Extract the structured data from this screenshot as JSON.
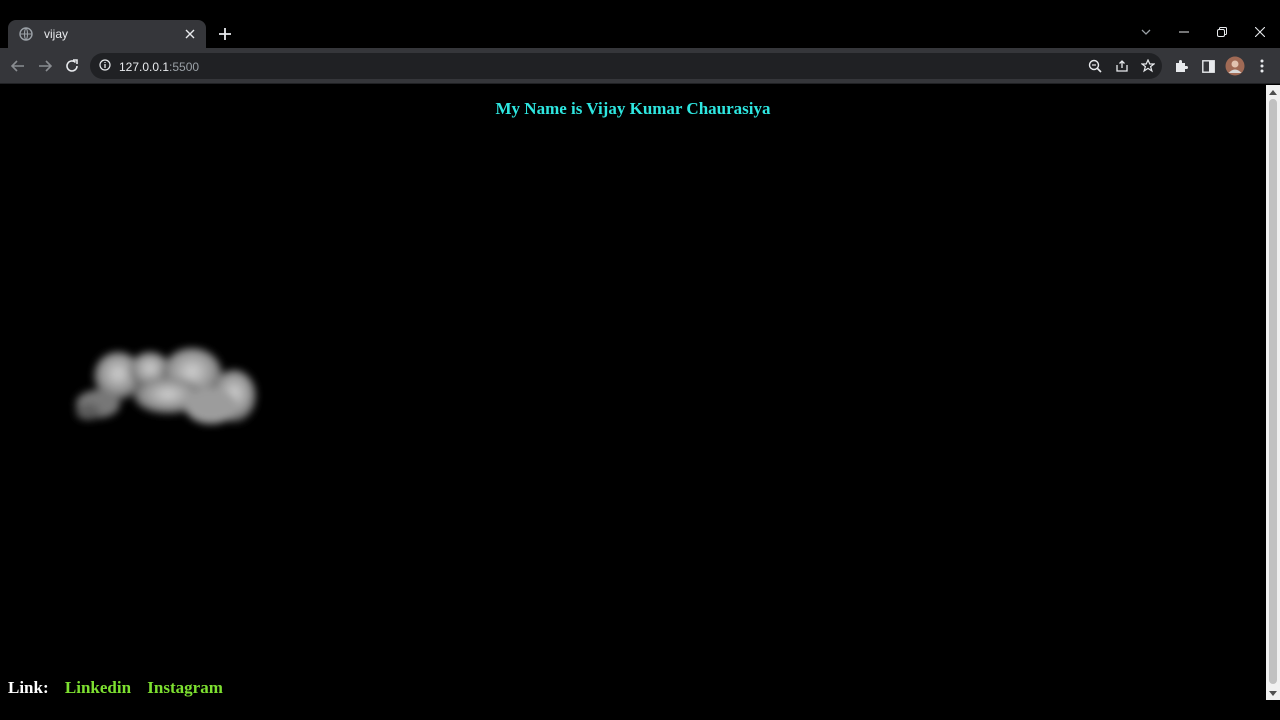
{
  "tab": {
    "title": "vijay"
  },
  "address_bar": {
    "url_host": "127.0.0.1",
    "url_port": ":5500"
  },
  "icons": {
    "favicon": "globe-icon",
    "close": "close-icon",
    "new_tab": "plus-icon",
    "tab_search": "chevron-down-icon",
    "minimize": "minimize-icon",
    "restore": "restore-icon",
    "window_close": "close-icon",
    "back": "back-arrow-icon",
    "forward": "forward-arrow-icon",
    "reload": "reload-icon",
    "info": "info-icon",
    "zoom": "zoom-icon",
    "share": "share-icon",
    "bookmark": "star-icon",
    "extensions": "puzzle-icon",
    "side_panel": "side-panel-icon",
    "profile": "avatar",
    "menu": "kebab-menu-icon"
  },
  "page": {
    "heading": "My Name is Vijay Kumar Chaurasiya",
    "footer": {
      "label": "Link:",
      "links": [
        "Linkedin",
        "Instagram"
      ]
    }
  },
  "colors": {
    "heading": "#2ee6e0",
    "link": "#7de030",
    "background": "#000000"
  }
}
